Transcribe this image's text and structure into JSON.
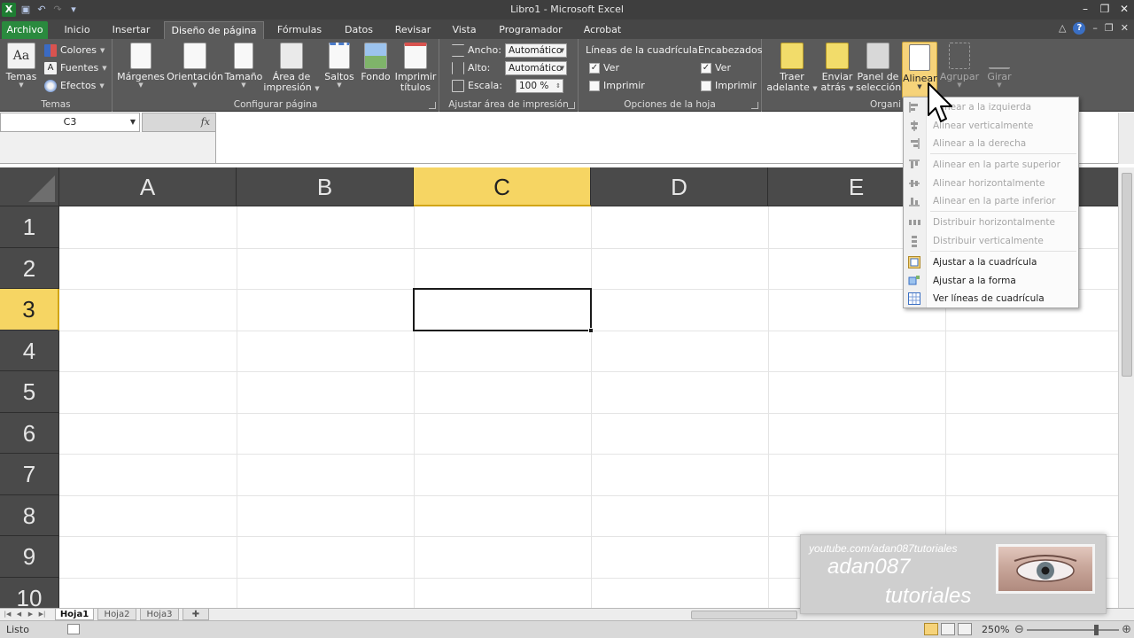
{
  "window": {
    "title": "Libro1  -  Microsoft Excel",
    "app_icon": "X"
  },
  "tabs": [
    {
      "label": "Archivo"
    },
    {
      "label": "Inicio"
    },
    {
      "label": "Insertar"
    },
    {
      "label": "Diseño de página"
    },
    {
      "label": "Fórmulas"
    },
    {
      "label": "Datos"
    },
    {
      "label": "Revisar"
    },
    {
      "label": "Vista"
    },
    {
      "label": "Programador"
    },
    {
      "label": "Acrobat"
    }
  ],
  "ribbon": {
    "temas": {
      "group_label": "Temas",
      "temas_btn": "Temas",
      "colores": "Colores",
      "fuentes": "Fuentes",
      "efectos": "Efectos"
    },
    "configurar": {
      "group_label": "Configurar página",
      "margenes": "Márgenes",
      "orientacion": "Orientación",
      "tamano": "Tamaño",
      "area_1": "Área de",
      "area_2": "impresión",
      "saltos": "Saltos",
      "fondo": "Fondo",
      "imprimir_1": "Imprimir",
      "imprimir_2": "títulos"
    },
    "ajustar": {
      "group_label": "Ajustar área de impresión",
      "ancho_label": "Ancho:",
      "ancho_value": "Automático",
      "alto_label": "Alto:",
      "alto_value": "Automático",
      "escala_label": "Escala:",
      "escala_value": "100 %"
    },
    "opciones": {
      "group_label": "Opciones de la hoja",
      "lineas_title": "Líneas de la cuadrícula",
      "lineas_ver": "Ver",
      "lineas_imprimir": "Imprimir",
      "enc_title": "Encabezados",
      "enc_ver": "Ver",
      "enc_imprimir": "Imprimir"
    },
    "organizar": {
      "group_label": "Organi",
      "traer_1": "Traer",
      "traer_2": "adelante",
      "enviar_1": "Enviar",
      "enviar_2": "atrás",
      "panel_1": "Panel de",
      "panel_2": "selección",
      "alinear": "Alinear",
      "agrupar": "Agrupar",
      "girar": "Girar"
    }
  },
  "formula_bar": {
    "name_box": "C3",
    "fx": "fx",
    "content": ""
  },
  "grid": {
    "columns": [
      "A",
      "B",
      "C",
      "D",
      "E"
    ],
    "rows": [
      "1",
      "2",
      "3",
      "4",
      "5",
      "6",
      "7",
      "8",
      "9",
      "10"
    ],
    "selected_column": "C",
    "selected_row": "3"
  },
  "menu": {
    "items": [
      {
        "label": "Alinear a la izquierda",
        "enabled": false,
        "icon": "align-left-icon"
      },
      {
        "label": "Alinear verticalmente",
        "enabled": false,
        "icon": "align-center-icon"
      },
      {
        "label": "Alinear a la derecha",
        "enabled": false,
        "icon": "align-right-icon"
      },
      {
        "label": "Alinear en la parte superior",
        "enabled": false,
        "icon": "align-top-icon"
      },
      {
        "label": "Alinear horizontalmente",
        "enabled": false,
        "icon": "align-middle-icon"
      },
      {
        "label": "Alinear en la parte inferior",
        "enabled": false,
        "icon": "align-bottom-icon"
      },
      {
        "label": "Distribuir horizontalmente",
        "enabled": false,
        "icon": "distribute-horizontal-icon"
      },
      {
        "label": "Distribuir verticalmente",
        "enabled": false,
        "icon": "distribute-vertical-icon"
      },
      {
        "label": "Ajustar a la cuadrícula",
        "enabled": true,
        "icon": "snap-to-grid-icon"
      },
      {
        "label": "Ajustar a la forma",
        "enabled": true,
        "icon": "snap-to-shape-icon"
      },
      {
        "label": "Ver líneas de cuadrícula",
        "enabled": true,
        "icon": "view-gridlines-icon"
      }
    ]
  },
  "sheets": [
    "Hoja1",
    "Hoja2",
    "Hoja3"
  ],
  "active_sheet": "Hoja1",
  "status": {
    "ready": "Listo",
    "zoom": "250%",
    "zoom_level": 250
  },
  "watermark": {
    "url": "youtube.com/adan087tutoriales",
    "name": "adan087",
    "sub": "tutoriales"
  },
  "colors": {
    "accent_green": "#2a8a3e",
    "selection_yellow": "#f6d563",
    "header_dark": "#4a4a4a"
  }
}
